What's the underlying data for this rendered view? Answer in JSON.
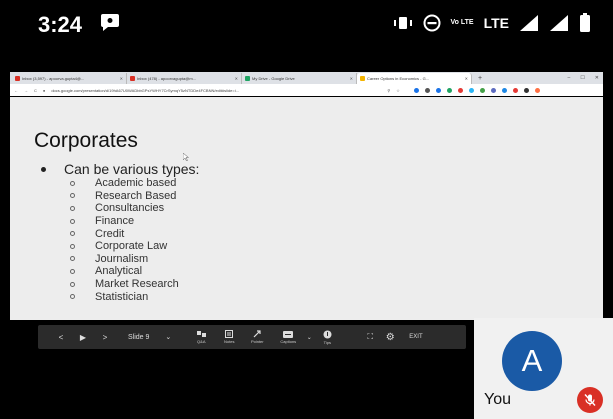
{
  "status_bar": {
    "time": "3:24",
    "network_label": "LTE",
    "volte_label": "Vo LTE",
    "icons": [
      "chat-icon",
      "vibrate-icon",
      "do-not-disturb-icon",
      "volte-icon",
      "lte-signal-icon",
      "signal-icon",
      "battery-icon"
    ]
  },
  "browser": {
    "tabs": [
      {
        "label": "Inbox (3,597) - apoorva.gupta4@...",
        "favicon": "gmail-icon",
        "color": "#d93025"
      },
      {
        "label": "Inbox (478) - apoorvagupta@m...",
        "favicon": "gmail-icon",
        "color": "#d93025"
      },
      {
        "label": "My Drive - Google Drive",
        "favicon": "drive-icon",
        "color": "#1fa463"
      },
      {
        "label": "Career Options in Economics - G...",
        "favicon": "slides-icon",
        "color": "#f4b400"
      }
    ],
    "new_tab": "+",
    "url": "docs.google.com/presentation/d/19hA67U0WADbbGPsYWHY7CrSymqY5zNTDDe4FCBNN/edit#slide=i..."
  },
  "slide": {
    "title": "Corporates",
    "bullet": "Can be various types:",
    "items": [
      "Academic based",
      "Research Based",
      "Consultancies",
      "Finance",
      "Credit",
      "Corporate Law",
      "Journalism",
      "Analytical",
      "Market Research",
      "Statistician"
    ]
  },
  "toolbar": {
    "prev": "<",
    "play": "▶",
    "next": ">",
    "slide_label": "Slide 9",
    "tools": [
      "Q&A",
      "Notes",
      "Pointer",
      "Captions",
      "Tips"
    ],
    "exit": "EXIT"
  },
  "meet": {
    "avatar_letter": "A",
    "you_label": "You",
    "avatar_color": "#1a5aa6",
    "mic_color": "#d93025"
  }
}
